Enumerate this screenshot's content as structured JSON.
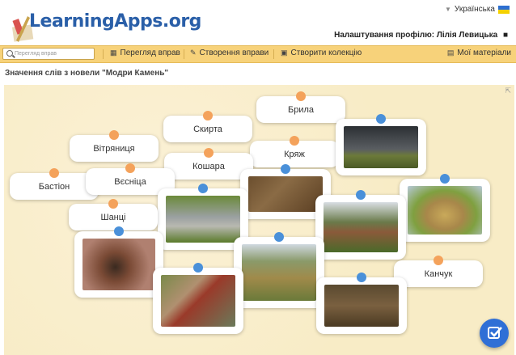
{
  "header": {
    "logo": "LearningApps.org",
    "language": "Українська",
    "profile": "Налаштування профілю: Лілія Левицька"
  },
  "nav": {
    "search_placeholder": "Перегляд вправ",
    "browse": "Перегляд вправ",
    "create": "Створення вправи",
    "collection": "Створити колекцію",
    "my_materials": "Мої матеріали"
  },
  "page": {
    "title": "Значення слів з новели \"Модри Камень\""
  },
  "words": [
    "Брила",
    "Скирта",
    "Вітряниця",
    "Кряж",
    "Кошара",
    "Бастіон",
    "Вєсніца",
    "Шанці",
    "Канчук"
  ],
  "photos": [
    "storm-landscape",
    "sheep-flock",
    "big-boulder",
    "hay-stack",
    "village-houses",
    "leather-whip",
    "hill-ridge",
    "castle-bastion",
    "trench"
  ],
  "colors": {
    "accent": "#f7d27a",
    "word_dot": "#f4a25b",
    "photo_dot": "#4a90d9",
    "board": "#f8ecc6",
    "submit": "#2f6fd6"
  }
}
